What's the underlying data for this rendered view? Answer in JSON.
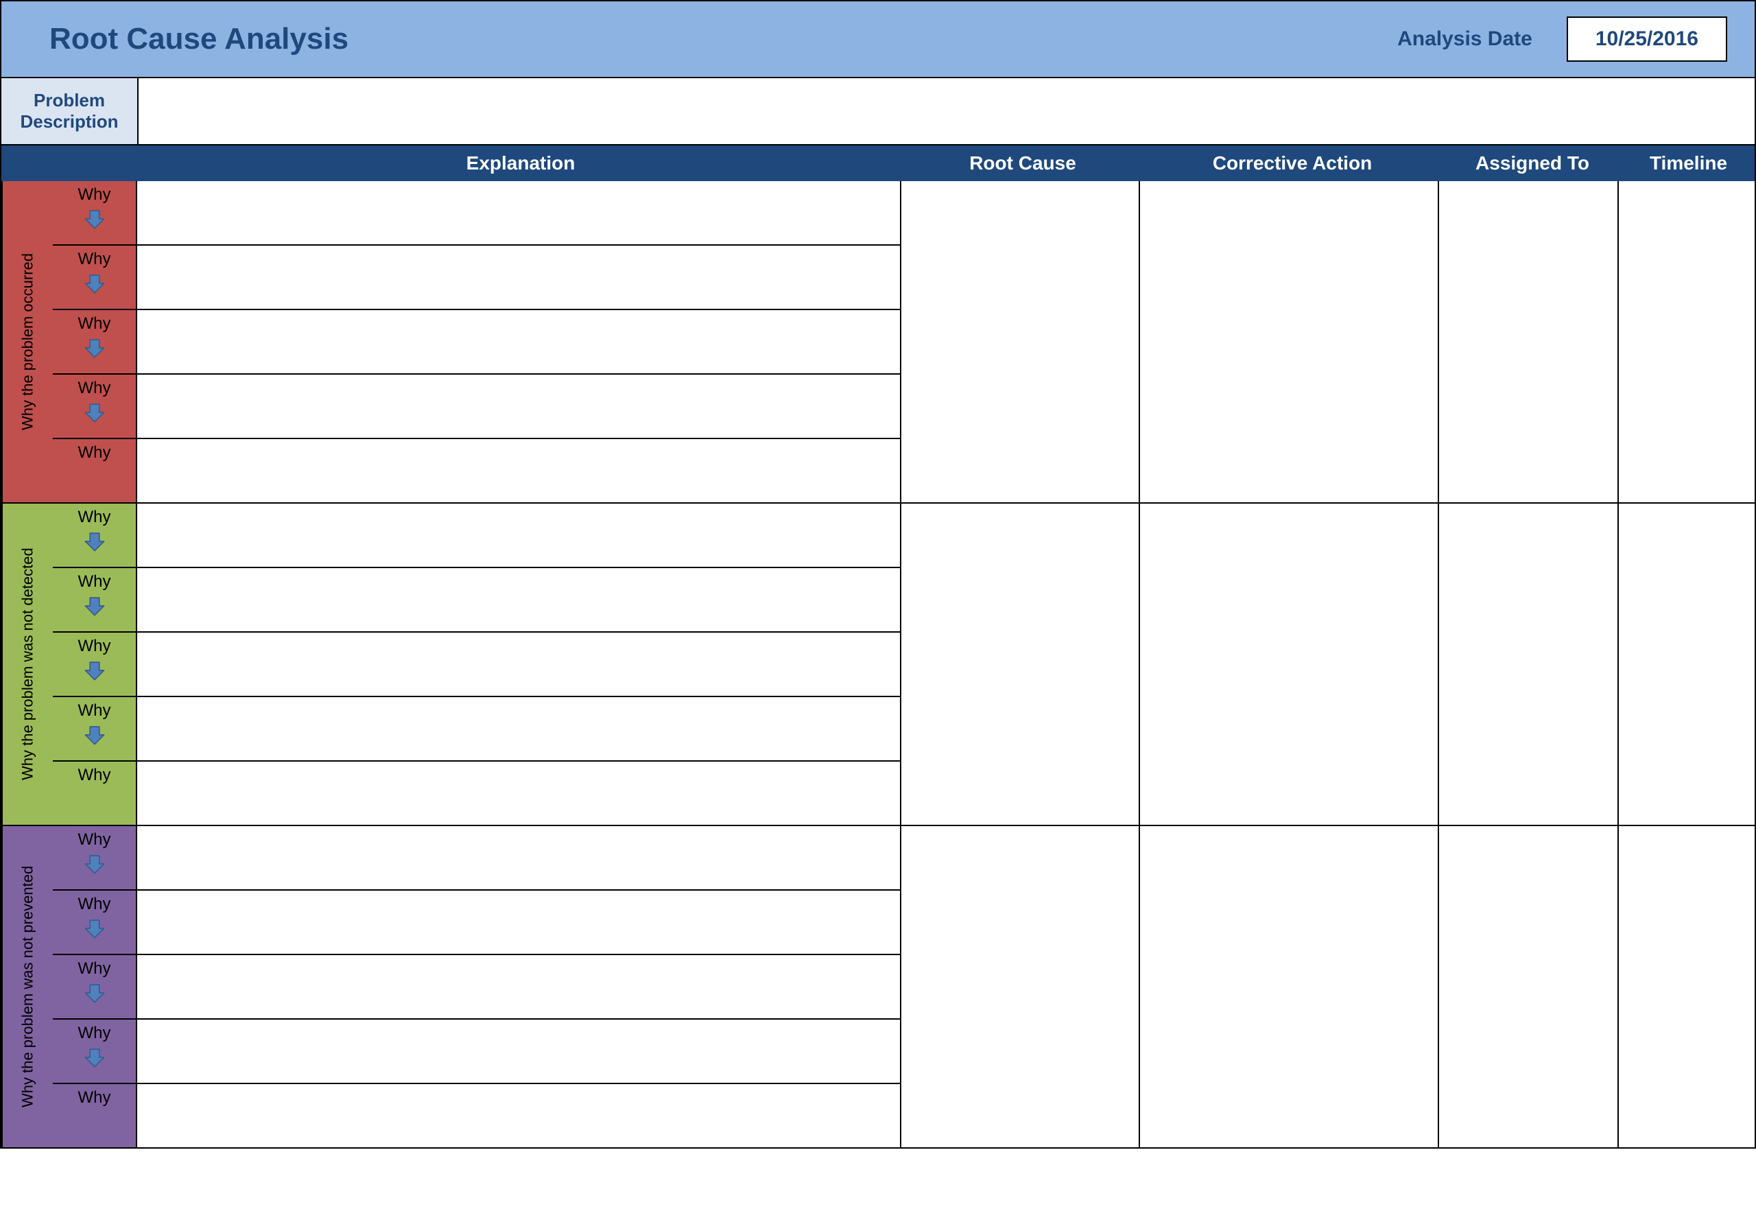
{
  "header": {
    "title": "Root Cause Analysis",
    "date_label": "Analysis Date",
    "date_value": "10/25/2016"
  },
  "problem": {
    "label": "Problem Description",
    "text": ""
  },
  "columns": {
    "explanation": "Explanation",
    "root_cause": "Root Cause",
    "corrective_action": "Corrective Action",
    "assigned_to": "Assigned To",
    "timeline": "Timeline"
  },
  "why_label": "Why",
  "sections": [
    {
      "id": "occurred",
      "side_label": "Why the problem occurred",
      "whys": [
        "",
        "",
        "",
        "",
        ""
      ],
      "root_cause": "",
      "corrective_action": "",
      "assigned_to": "",
      "timeline": ""
    },
    {
      "id": "detected",
      "side_label": "Why the problem was not detected",
      "whys": [
        "",
        "",
        "",
        "",
        ""
      ],
      "root_cause": "",
      "corrective_action": "",
      "assigned_to": "",
      "timeline": ""
    },
    {
      "id": "prevented",
      "side_label": "Why the problem was not prevented",
      "whys": [
        "",
        "",
        "",
        "",
        ""
      ],
      "root_cause": "",
      "corrective_action": "",
      "assigned_to": "",
      "timeline": ""
    }
  ]
}
